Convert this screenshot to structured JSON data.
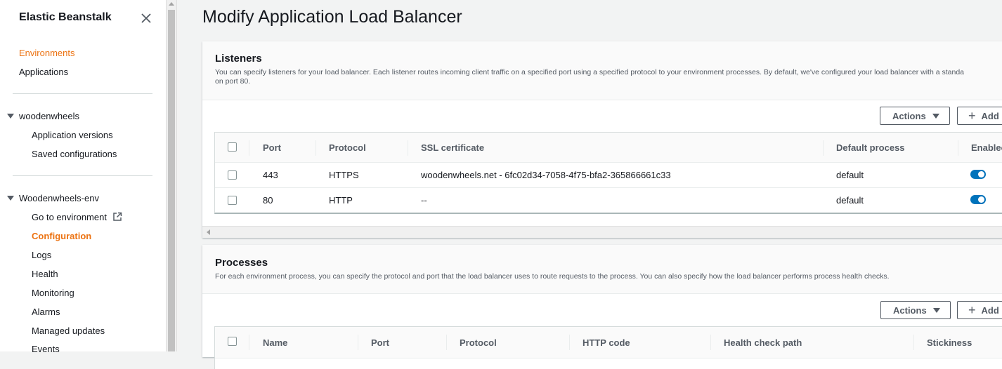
{
  "sidebar": {
    "title": "Elastic Beanstalk",
    "top_links": [
      {
        "label": "Environments",
        "active": true
      },
      {
        "label": "Applications",
        "active": false
      }
    ],
    "app_section": {
      "name": "woodenwheels",
      "items": [
        "Application versions",
        "Saved configurations"
      ]
    },
    "env_section": {
      "name": "Woodenwheels-env",
      "items": [
        {
          "label": "Go to environment",
          "external": true
        },
        {
          "label": "Configuration",
          "active": true
        },
        {
          "label": "Logs"
        },
        {
          "label": "Health"
        },
        {
          "label": "Monitoring"
        },
        {
          "label": "Alarms"
        },
        {
          "label": "Managed updates"
        },
        {
          "label": "Events"
        }
      ]
    }
  },
  "page": {
    "title": "Modify Application Load Balancer"
  },
  "listeners": {
    "heading": "Listeners",
    "description": "You can specify listeners for your load balancer. Each listener routes incoming client traffic on a specified port using a specified protocol to your environment processes. By default, we've configured your load balancer with a standa",
    "description_line2": "on port 80.",
    "actions_label": "Actions",
    "add_label": "Add",
    "columns": [
      "Port",
      "Protocol",
      "SSL certificate",
      "Default process",
      "Enablec"
    ],
    "rows": [
      {
        "port": "443",
        "protocol": "HTTPS",
        "ssl": "woodenwheels.net - 6fc02d34-7058-4f75-bfa2-365866661c33",
        "process": "default",
        "enabled": true
      },
      {
        "port": "80",
        "protocol": "HTTP",
        "ssl": "--",
        "process": "default",
        "enabled": true
      }
    ]
  },
  "processes": {
    "heading": "Processes",
    "description": "For each environment process, you can specify the protocol and port that the load balancer uses to route requests to the process. You can also specify how the load balancer performs process health checks.",
    "actions_label": "Actions",
    "add_label": "Add",
    "columns": [
      "Name",
      "Port",
      "Protocol",
      "HTTP code",
      "Health check path",
      "Stickiness"
    ]
  },
  "colors": {
    "accent": "#ec7211",
    "toggle_on": "#0073bb"
  }
}
